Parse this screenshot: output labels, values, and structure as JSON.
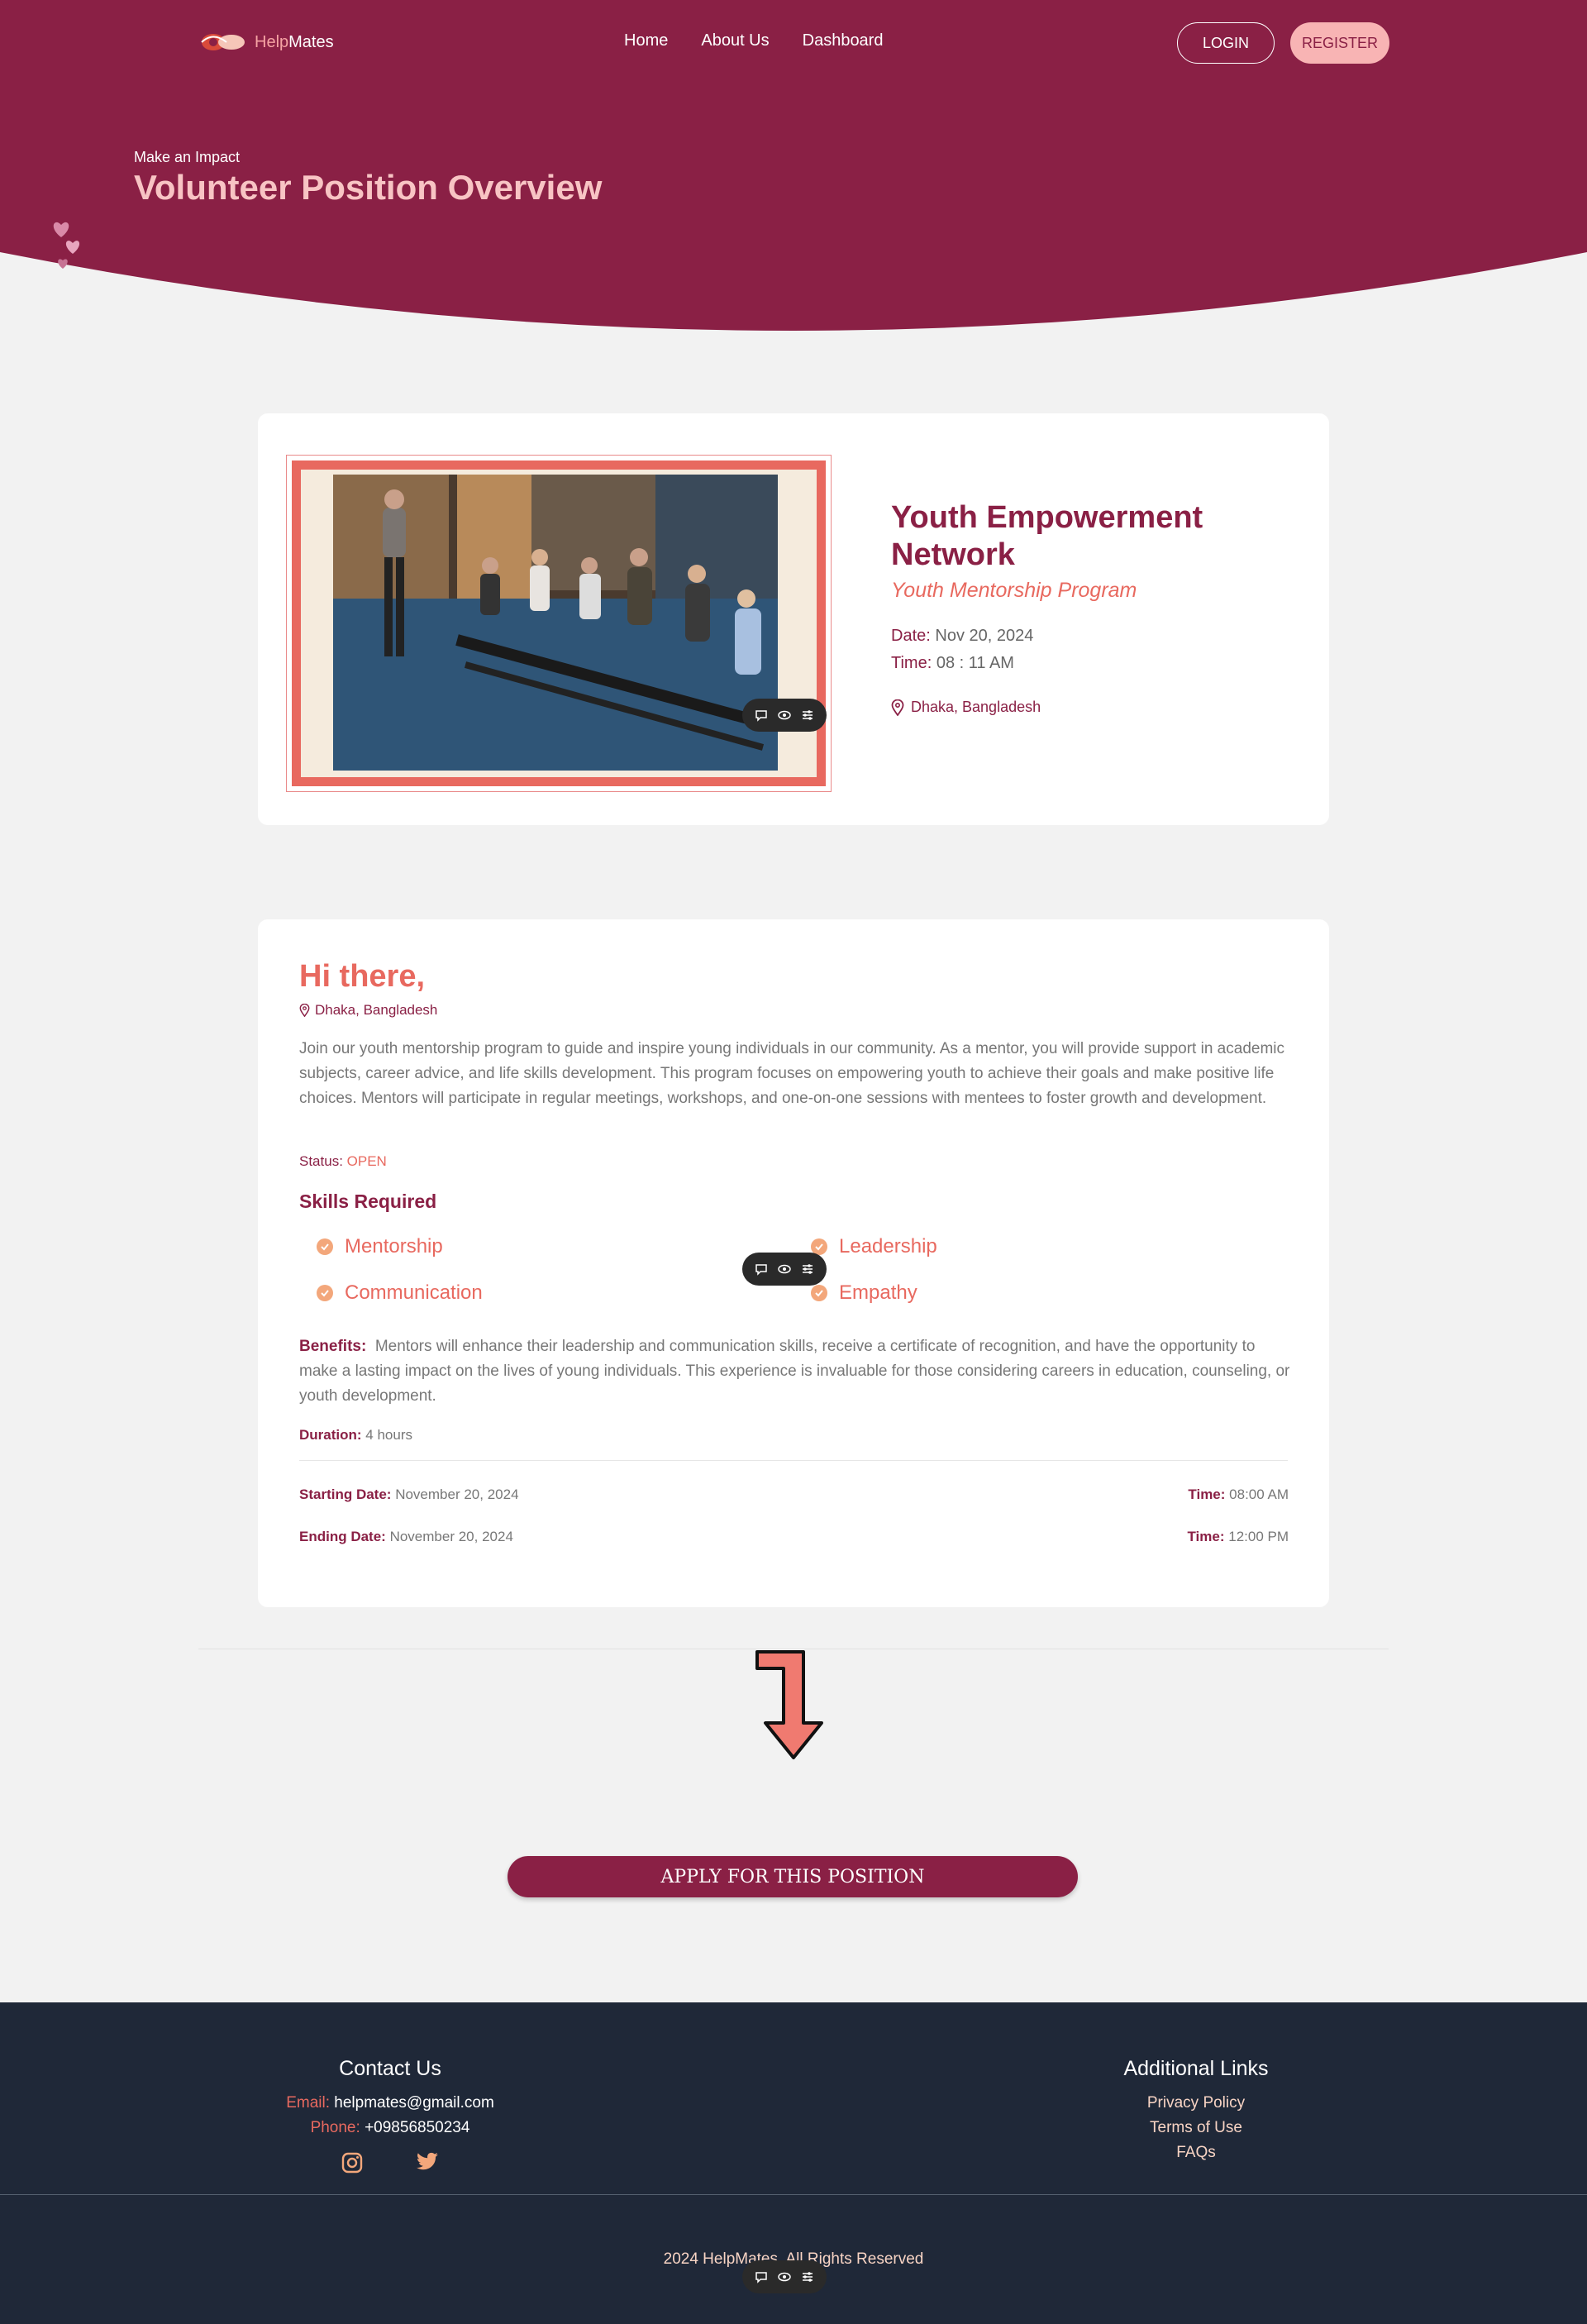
{
  "header": {
    "logo_text_a": "Help",
    "logo_text_b": "Mates",
    "nav": [
      "Home",
      "About Us",
      "Dashboard"
    ],
    "login_label": "LOGIN",
    "register_label": "REGISTER",
    "subtitle": "Make an Impact",
    "title": "Volunteer Position Overview"
  },
  "colors": {
    "brand": "#8a2045",
    "accent": "#e8695f",
    "footer": "#1f2838"
  },
  "overview": {
    "organization": "Youth Empowerment Network",
    "program": "Youth Mentorship Program",
    "date_label": "Date:",
    "date": "Nov 20, 2024",
    "time_label": "Time:",
    "time": "08 : 11 AM",
    "location": "Dhaka, Bangladesh"
  },
  "details": {
    "greeting": "Hi there,",
    "location": "Dhaka, Bangladesh",
    "description": "Join our youth mentorship program to guide and inspire young individuals in our community. As a mentor, you will provide support in academic subjects, career advice, and life skills development. This program focuses on empowering youth to achieve their goals and make positive life choices. Mentors will participate in regular meetings, workshops, and one-on-one sessions with mentees to foster growth and development.",
    "status_label": "Status:",
    "status": "OPEN",
    "skills_heading": "Skills Required",
    "skills": [
      "Mentorship",
      "Leadership",
      "Communication",
      "Empathy"
    ],
    "benefits_label": "Benefits:",
    "benefits": "Mentors will enhance their leadership and communication skills, receive a certificate of recognition, and have the opportunity to make a lasting impact on the lives of young individuals. This experience is invaluable for those considering careers in education, counseling, or youth development.",
    "duration_label": "Duration:",
    "duration": "4 hours",
    "start_label": "Starting Date:",
    "start_date": "November 20, 2024",
    "end_label": "Ending Date:",
    "end_date": "November 20, 2024",
    "time_label": "Time:",
    "start_time": "08:00 AM",
    "end_time": "12:00 PM"
  },
  "apply_label": "APPLY FOR THIS POSITION",
  "footer": {
    "contact_heading": "Contact Us",
    "email_label": "Email:",
    "email": "helpmates@gmail.com",
    "phone_label": "Phone:",
    "phone": "+09856850234",
    "links_heading": "Additional Links",
    "links": [
      "Privacy Policy",
      "Terms of Use",
      "FAQs"
    ],
    "copyright": "2024 HelpMates. All Rights Reserved"
  },
  "icons": [
    "logo-icon",
    "heart-icon",
    "location-pin-icon",
    "check-icon",
    "comment-icon",
    "eye-icon",
    "sliders-icon",
    "instagram-icon",
    "twitter-icon",
    "arrow-down-icon"
  ]
}
